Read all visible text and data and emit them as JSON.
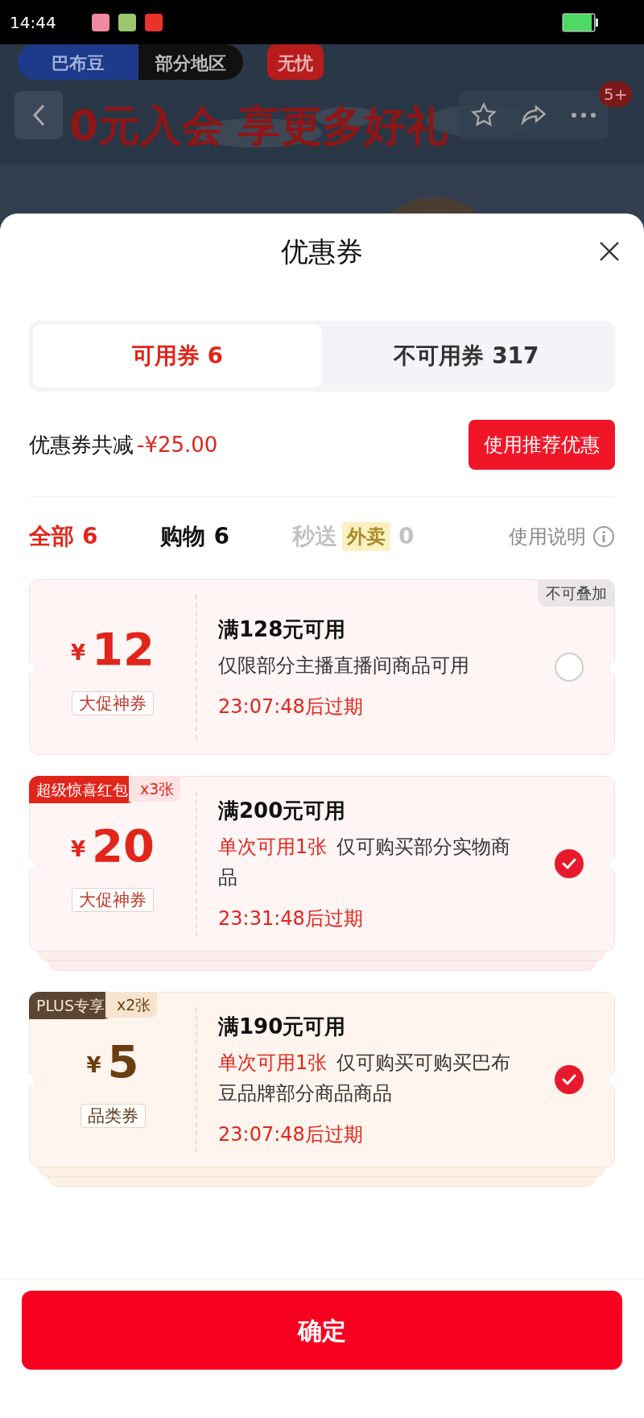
{
  "status_bar": {
    "time": "14:44"
  },
  "background_page": {
    "tags": [
      {
        "text": "巴布豆",
        "kind": "brand"
      },
      {
        "text": "部分地区",
        "kind": "region"
      },
      {
        "text": "无忧",
        "kind": "promise"
      }
    ],
    "headline": "0元入会 享更多好礼",
    "badge": "5+"
  },
  "sheet": {
    "title": "优惠券",
    "tabs": [
      {
        "label": "可用券 6",
        "selected": true
      },
      {
        "label": "不可用券 317",
        "selected": false
      }
    ],
    "summary": {
      "label": "优惠券共减",
      "amount": "-¥25.00",
      "button": "使用推荐优惠"
    },
    "filters": [
      {
        "label": "全部",
        "count": "6",
        "selected": true,
        "disabled": false
      },
      {
        "label": "购物",
        "count": "6",
        "selected": false,
        "disabled": false
      },
      {
        "label": "秒送",
        "tag": "外卖",
        "count": "0",
        "selected": false,
        "disabled": true
      }
    ],
    "help_link": "使用说明",
    "coupons": [
      {
        "kind": "promo",
        "currency": "¥",
        "amount": "12",
        "category": "大促神券",
        "note": "不可叠加",
        "condition": "满128元可用",
        "description": "仅限部分主播直播间商品可用",
        "expiry": "23:07:48后过期",
        "checked": false,
        "stacked": false
      },
      {
        "kind": "promo",
        "currency": "¥",
        "amount": "20",
        "category": "大促神券",
        "ribbon": {
          "label": "超级惊喜红包",
          "count": "x3张"
        },
        "condition": "满200元可用",
        "limit": "单次可用1张",
        "description": "仅可购买部分实物商品",
        "expiry": "23:31:48后过期",
        "checked": true,
        "stacked": true
      },
      {
        "kind": "plus",
        "currency": "¥",
        "amount": "5",
        "category": "品类券",
        "ribbon": {
          "label": "PLUS专享",
          "count": "x2张"
        },
        "condition": "满190元可用",
        "limit": "单次可用1张",
        "description": "仅可购买可购买巴布豆品牌部分商品商品",
        "expiry": "23:07:48后过期",
        "checked": true,
        "stacked": true
      }
    ],
    "confirm_button": "确定"
  }
}
